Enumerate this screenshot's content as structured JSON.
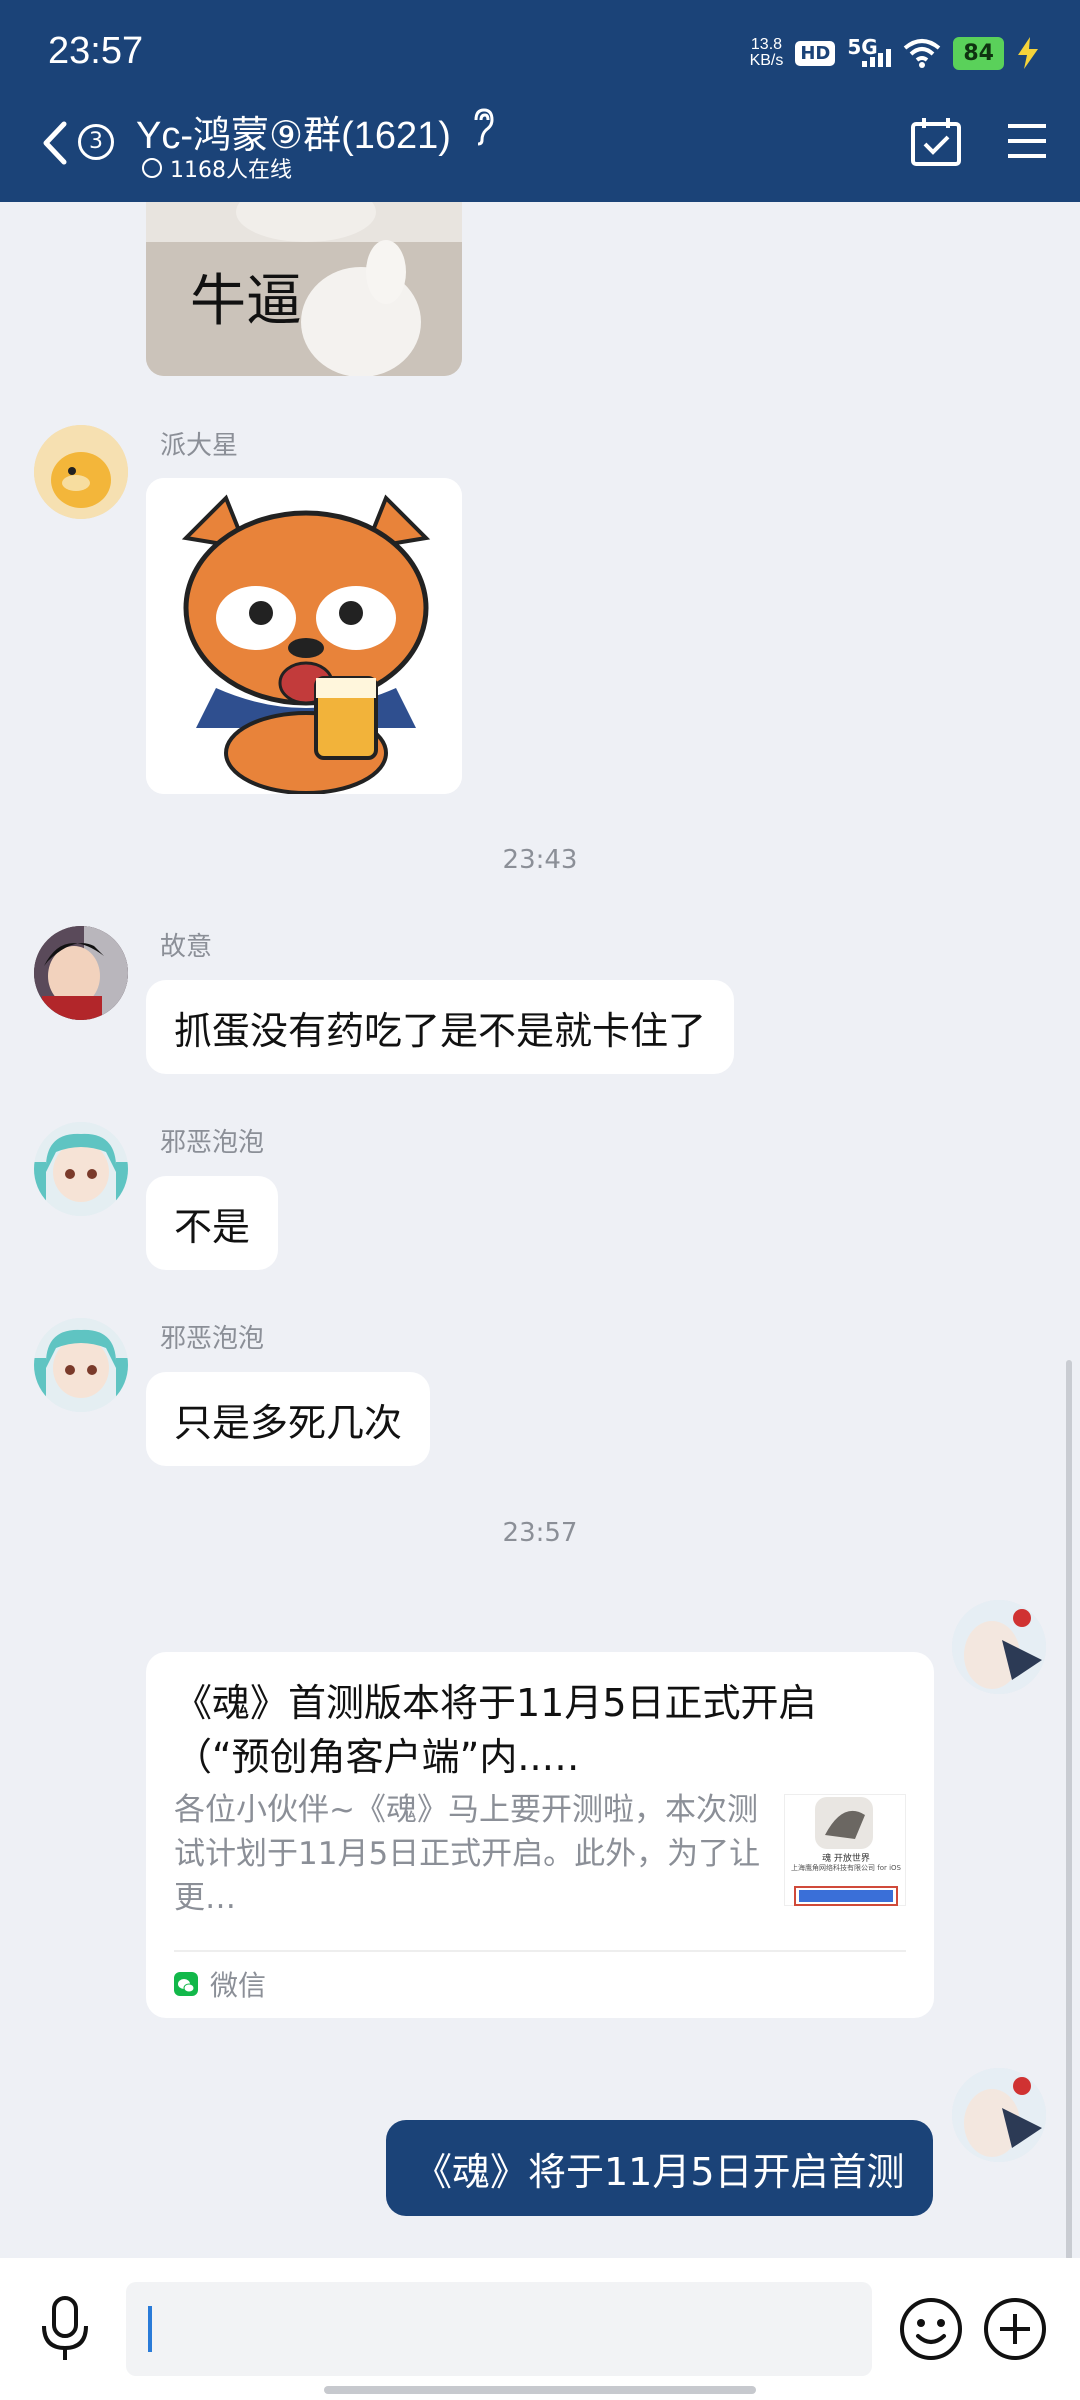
{
  "status": {
    "time": "23:57",
    "net_speed_value": "13.8",
    "net_speed_unit": "KB/s",
    "hd": "HD",
    "network": "5G",
    "battery": "84"
  },
  "header": {
    "badge": "3",
    "title": "Yc-鸿蒙⑨群(1621)",
    "online": "1168人在线"
  },
  "sticker_top": {
    "text": "牛逼"
  },
  "messages": [
    {
      "sender": "派大星"
    },
    {
      "time": "23:43"
    },
    {
      "sender": "故意",
      "text": "抓蛋没有药吃了是不是就卡住了"
    },
    {
      "sender": "邪恶泡泡",
      "text": "不是"
    },
    {
      "sender": "邪恶泡泡",
      "text": "只是多死几次"
    },
    {
      "time": "23:57"
    }
  ],
  "card": {
    "title": "《魂》首测版本将于11月5日正式开启（“预创角客户端”内..…",
    "desc": "各位小伙伴~《魂》马上要开测啦，本次测试计划于11月5日正式开启。此外，为了让更…",
    "source": "微信",
    "thumb_text": "魂 开放世界",
    "thumb_sub": "上海鹰角网络科技有限公司 for iOS"
  },
  "my_message": {
    "text": "《魂》将于11月5日开启首测"
  },
  "input": {
    "placeholder": ""
  },
  "colors": {
    "header": "#1b4378",
    "background": "#eef0f5",
    "my_bubble": "#1b4378"
  }
}
